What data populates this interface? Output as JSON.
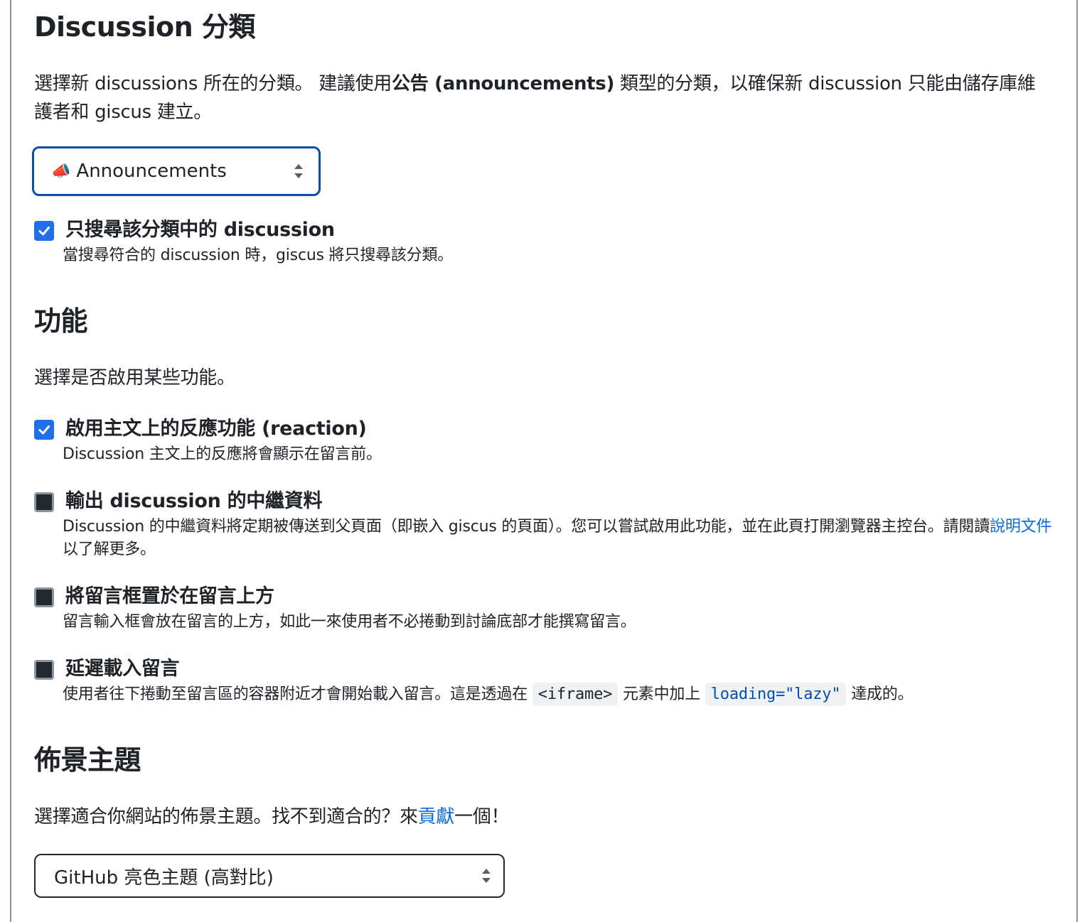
{
  "category_section": {
    "heading": "Discussion 分類",
    "desc_pre": "選擇新 discussions 所在的分類。 建議使用",
    "desc_bold": "公告 (announcements)",
    "desc_post": " 類型的分類，以確保新 discussion 只能由儲存庫維護者和 giscus 建立。",
    "select_icon": "📣",
    "select_value": "Announcements",
    "strict": {
      "checked": true,
      "title": "只搜尋該分類中的 discussion",
      "desc": "當搜尋符合的 discussion 時，giscus 將只搜尋該分類。"
    }
  },
  "features_section": {
    "heading": "功能",
    "desc": "選擇是否啟用某些功能。",
    "reactions": {
      "checked": true,
      "title": "啟用主文上的反應功能 (reaction)",
      "desc": "Discussion 主文上的反應將會顯示在留言前。"
    },
    "metadata": {
      "checked": false,
      "title": "輸出 discussion 的中繼資料",
      "desc_pre": "Discussion 的中繼資料將定期被傳送到父頁面（即嵌入 giscus 的頁面）。您可以嘗試啟用此功能，並在此頁打開瀏覽器主控台。請閱讀",
      "desc_link": "說明文件",
      "desc_post": "以了解更多。"
    },
    "input_top": {
      "checked": false,
      "title": "將留言框置於在留言上方",
      "desc": "留言輸入框會放在留言的上方，如此一來使用者不必捲動到討論底部才能撰寫留言。"
    },
    "lazy": {
      "checked": false,
      "title": "延遲載入留言",
      "desc_pre": "使用者往下捲動至留言區的容器附近才會開始載入留言。這是透過在 ",
      "code1": "<iframe>",
      "desc_mid": " 元素中加上 ",
      "code2": "loading=\"lazy\"",
      "desc_post": " 達成的。"
    }
  },
  "theme_section": {
    "heading": "佈景主題",
    "desc_pre": "選擇適合你網站的佈景主題。找不到適合的？來",
    "desc_link": "貢獻",
    "desc_post": "一個！",
    "select_value": "GitHub 亮色主題 (高對比)"
  },
  "colors": {
    "accent": "#1f6feb",
    "link": "#0969da",
    "focus_border": "#0550ae",
    "text": "#1f2328"
  }
}
